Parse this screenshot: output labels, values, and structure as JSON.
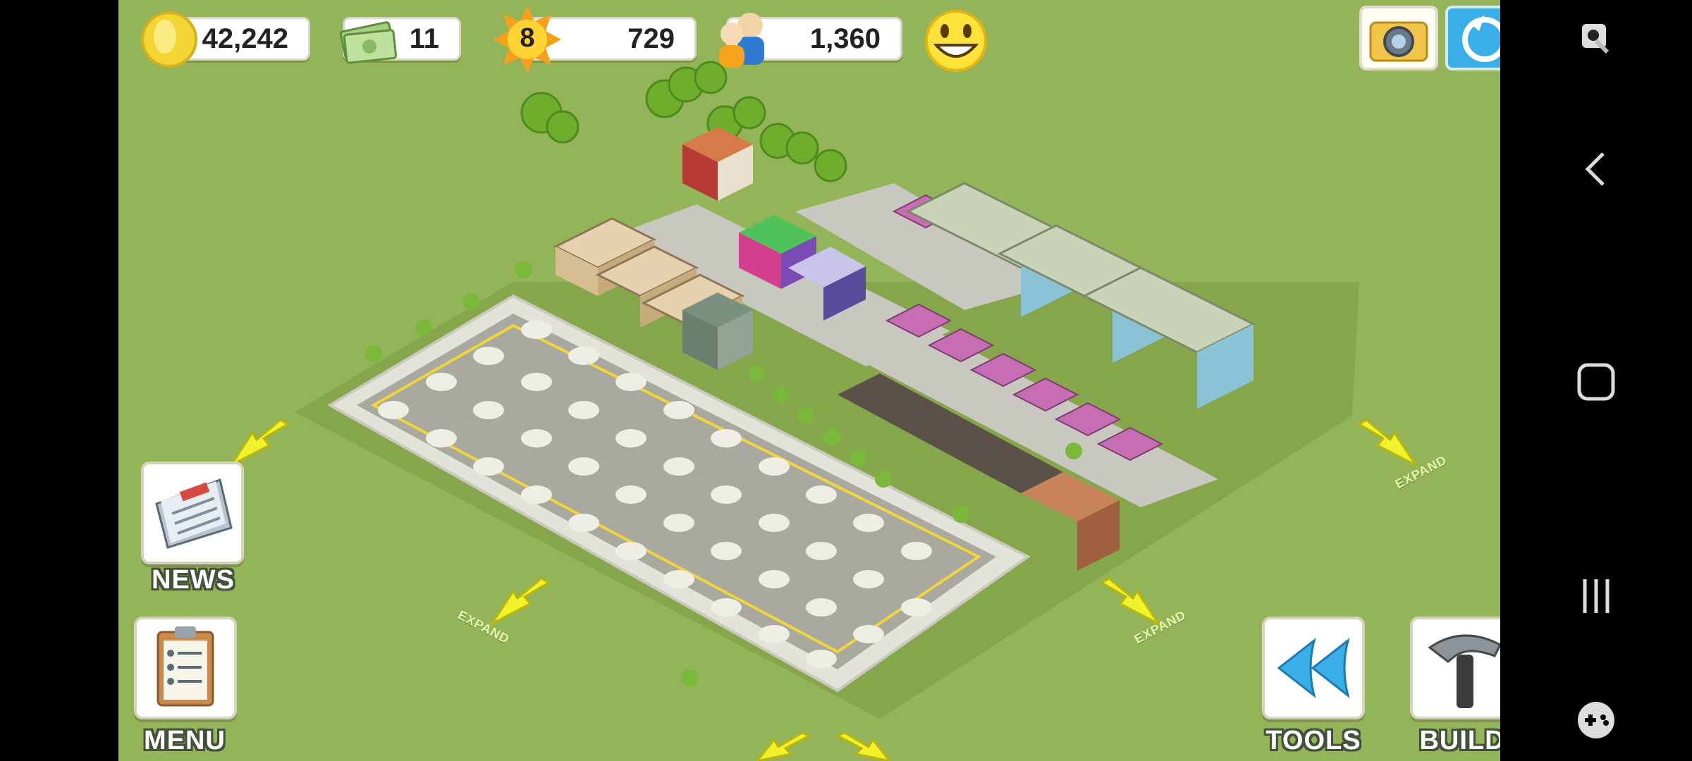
{
  "stats": {
    "coins": "42,242",
    "cash": "11",
    "level": "8",
    "xp": "729",
    "population": "1,360"
  },
  "buttons": {
    "news": "NEWS",
    "menu": "MENU",
    "tools": "TOOLS",
    "build": "BUILD"
  },
  "expand": {
    "label": "EXPAND"
  },
  "colors": {
    "grass": "#93b458",
    "accent": "#3aaee6",
    "roof": "#b35ca3",
    "road": "#c8c8c0"
  }
}
